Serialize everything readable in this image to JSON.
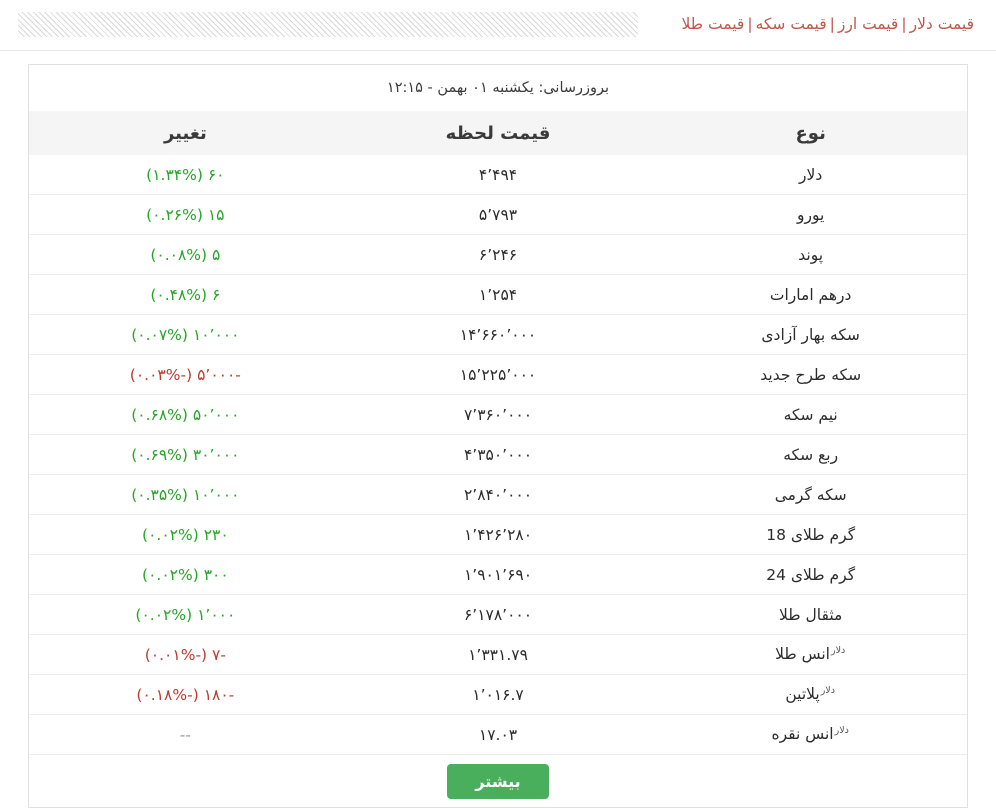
{
  "header": {
    "links": [
      {
        "label": "قیمت دلار"
      },
      {
        "label": "قیمت ارز"
      },
      {
        "label": "قیمت سکه"
      },
      {
        "label": "قیمت طلا"
      }
    ],
    "separator": "|",
    "link_color": "#c0574b"
  },
  "table": {
    "update_line": "بروزرسانی: یکشنبه ۰۱ بهمن - ۱۲:۱۵",
    "columns": {
      "type": "نوع",
      "price": "قیمت لحظه",
      "change": "تغییر"
    },
    "unit_superscript": "دلار",
    "colors": {
      "up": "#27a527",
      "down": "#bd3b2e",
      "flat": "#999999",
      "button": "#4aaf5c",
      "header_bg": "#f5f5f5"
    },
    "rows": [
      {
        "type": "دلار",
        "unit": "",
        "price": "۴٬۴۹۴",
        "change": "۶۰ (۱.۳۴%)",
        "dir": "up"
      },
      {
        "type": "یورو",
        "unit": "",
        "price": "۵٬۷۹۳",
        "change": "۱۵ (۰.۲۶%)",
        "dir": "up"
      },
      {
        "type": "پوند",
        "unit": "",
        "price": "۶٬۲۴۶",
        "change": "۵ (۰.۰۸%)",
        "dir": "up"
      },
      {
        "type": "درهم امارات",
        "unit": "",
        "price": "۱٬۲۵۴",
        "change": "۶ (۰.۴۸%)",
        "dir": "up"
      },
      {
        "type": "سکه بهار آزادی",
        "unit": "",
        "price": "۱۴٬۶۶۰٬۰۰۰",
        "change": "۱۰٬۰۰۰ (۰.۰۷%)",
        "dir": "up"
      },
      {
        "type": "سکه طرح جدید",
        "unit": "",
        "price": "۱۵٬۲۲۵٬۰۰۰",
        "change": "-۵٬۰۰۰ (-۰.۰۳%)",
        "dir": "down"
      },
      {
        "type": "نیم سکه",
        "unit": "",
        "price": "۷٬۳۶۰٬۰۰۰",
        "change": "۵۰٬۰۰۰ (۰.۶۸%)",
        "dir": "up"
      },
      {
        "type": "ربع سکه",
        "unit": "",
        "price": "۴٬۳۵۰٬۰۰۰",
        "change": "۳۰٬۰۰۰ (۰.۶۹%)",
        "dir": "up"
      },
      {
        "type": "سکه گرمی",
        "unit": "",
        "price": "۲٬۸۴۰٬۰۰۰",
        "change": "۱۰٬۰۰۰ (۰.۳۵%)",
        "dir": "up"
      },
      {
        "type": "گرم طلای 18",
        "unit": "",
        "price": "۱٬۴۲۶٬۲۸۰",
        "change": "۲۳۰ (۰.۰۲%)",
        "dir": "up"
      },
      {
        "type": "گرم طلای 24",
        "unit": "",
        "price": "۱٬۹۰۱٬۶۹۰",
        "change": "۳۰۰ (۰.۰۲%)",
        "dir": "up"
      },
      {
        "type": "مثقال طلا",
        "unit": "",
        "price": "۶٬۱۷۸٬۰۰۰",
        "change": "۱٬۰۰۰ (۰.۰۲%)",
        "dir": "up"
      },
      {
        "type": "انس طلا",
        "unit": "دلار",
        "price": "۱٬۳۳۱.۷۹",
        "change": "-۷ (-۰.۰۱%)",
        "dir": "down"
      },
      {
        "type": "پلاتین",
        "unit": "دلار",
        "price": "۱٬۰۱۶.۷",
        "change": "-۱۸۰ (-۰.۱۸%)",
        "dir": "down"
      },
      {
        "type": "انس نقره",
        "unit": "دلار",
        "price": "۱۷.۰۳",
        "change": "--",
        "dir": "flat"
      }
    ],
    "more_button": "بیشتر"
  }
}
